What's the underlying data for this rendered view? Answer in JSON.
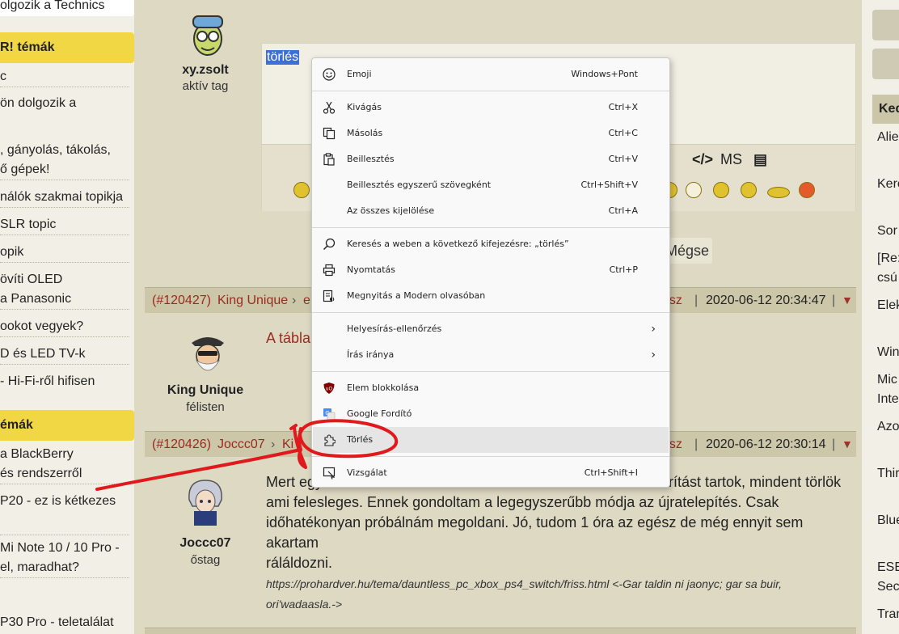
{
  "left_sidebar": {
    "top_item": "olgozik a Technics",
    "heading1": "R! témák",
    "items1": [
      "c",
      "ön dolgozik a",
      ", gányolás, tákolás,",
      "ő gépek!",
      "nálók szakmai topikja",
      "SLR topic",
      "opik",
      "övíti OLED",
      "a Panasonic",
      "ookot vegyek?",
      "D és LED TV-k",
      "- Hi-Fi-ről hifisen"
    ],
    "heading2": "émák",
    "items2": [
      "a BlackBerry",
      "és rendszerről",
      "P20 - ez is kétkezes",
      "Mi Note 10 / 10 Pro -",
      "el, maradhat?",
      "P30 Pro - teletalálat"
    ]
  },
  "right_sidebar": {
    "heading": "Ked",
    "items": [
      "Alie",
      "Kere",
      "Sor",
      "[Re:",
      "csú",
      "Elek",
      "Win",
      "Mic",
      "Inte",
      "Azo",
      "Thir",
      "Blue",
      "ESE",
      "Sec",
      "Tran"
    ]
  },
  "posts": [
    {
      "user": "xy.zsolt",
      "rank": "aktív tag"
    },
    {
      "user": "King Unique",
      "rank": "félisten",
      "num": "(#120427)",
      "from": "King Unique",
      "to": "e",
      "tail": "asz",
      "date": "2020-06-12 20:34:47",
      "body": "A tábla"
    },
    {
      "user": "Joccc07",
      "rank": "őstag",
      "num": "(#120426)",
      "from": "Joccc07",
      "to": "Ki",
      "tail": "asz",
      "date": "2020-06-12 20:30:14"
    }
  ],
  "editor": {
    "selected_text": "törlés",
    "toolbar_ms": "MS",
    "cancel_label": "Mégse"
  },
  "post3_body": {
    "line1_left": "Mert egy",
    "line1_right": "arítást tartok, mindent törlök",
    "line2": "ami felesleges. Ennek gondoltam a legegyszerűbb módja az újratelepítés. Csak",
    "line3": "időhatékonyan próbálnám megoldani. Jó, tudom 1 óra az egész de még ennyit sem akartam",
    "line4": "ráláldozni.",
    "quote1": "https://prohardver.hu/tema/dauntless_pc_xbox_ps4_switch/friss.html <-Gar taldin ni jaonyc; gar sa buir,",
    "quote2": "ori'wadaasla.->"
  },
  "context_menu": {
    "items": [
      {
        "label": "Emoji",
        "shortcut": "Windows+Pont",
        "icon": "emoji-icon"
      },
      {
        "label": "Kivágás",
        "shortcut": "Ctrl+X",
        "icon": "scissors-icon"
      },
      {
        "label": "Másolás",
        "shortcut": "Ctrl+C",
        "icon": "copy-icon"
      },
      {
        "label": "Beillesztés",
        "shortcut": "Ctrl+V",
        "icon": "paste-icon"
      },
      {
        "label": "Beillesztés egyszerű szövegként",
        "shortcut": "Ctrl+Shift+V"
      },
      {
        "label": "Az összes kijelölése",
        "shortcut": "Ctrl+A"
      },
      {
        "label": "Keresés a weben a következő kifejezésre: „törlés”",
        "icon": "search-icon"
      },
      {
        "label": "Nyomtatás",
        "shortcut": "Ctrl+P",
        "icon": "print-icon"
      },
      {
        "label": "Megnyitás a Modern olvasóban",
        "icon": "reader-icon"
      },
      {
        "label": "Helyesírás-ellenőrzés",
        "submenu": true
      },
      {
        "label": "Írás iránya",
        "submenu": true
      },
      {
        "label": "Elem blokkolása",
        "icon": "ublock-icon"
      },
      {
        "label": "Google Fordító",
        "icon": "google-translate-icon"
      },
      {
        "label": "Törlés",
        "icon": "puzzle-icon",
        "highlighted": true
      },
      {
        "label": "Vizsgálat",
        "shortcut": "Ctrl+Shift+I",
        "icon": "inspect-icon"
      }
    ]
  },
  "colors": {
    "accent_red": "#9a2a1f",
    "highlight_yellow": "#f2d745",
    "annotation_red": "#e0191c"
  }
}
